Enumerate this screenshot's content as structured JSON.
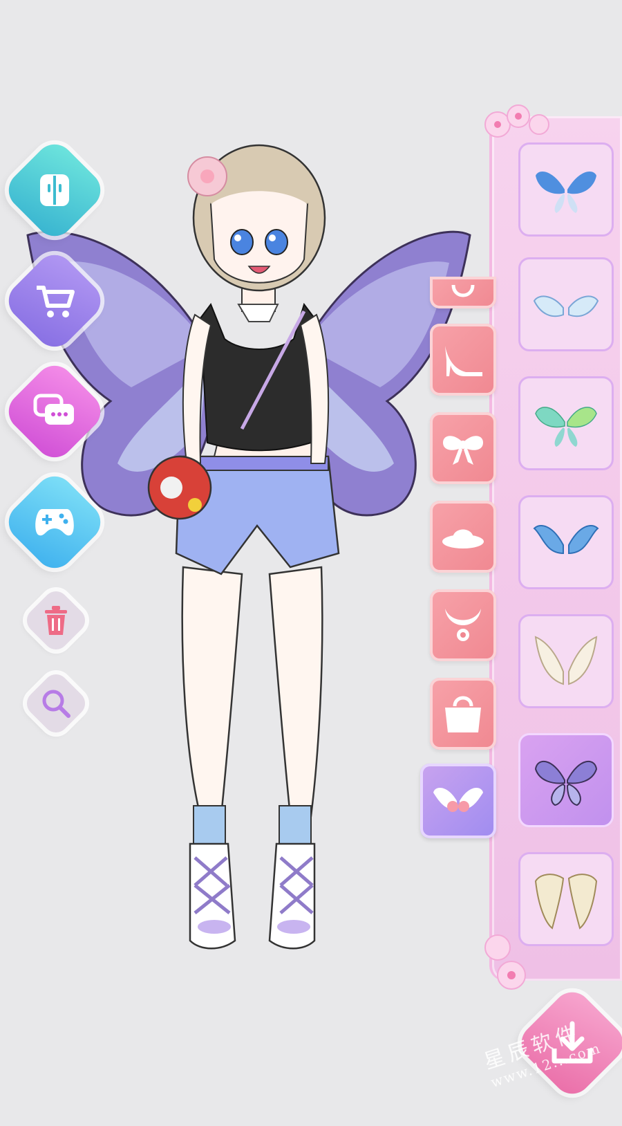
{
  "left_buttons": [
    {
      "name": "wardrobe-button",
      "icon": "wardrobe-icon",
      "color_top": "#5fe0d8",
      "color_bottom": "#38b7cf"
    },
    {
      "name": "shop-button",
      "icon": "cart-icon",
      "color_top": "#a88df0",
      "color_bottom": "#8a74e6"
    },
    {
      "name": "chat-button",
      "icon": "chat-icon",
      "color_top": "#f27de6",
      "color_bottom": "#d553d8"
    },
    {
      "name": "game-button",
      "icon": "gamepad-icon",
      "color_top": "#6ad6f5",
      "color_bottom": "#40b4ef"
    }
  ],
  "tool_buttons": [
    {
      "name": "delete-button",
      "icon": "trash-icon",
      "color": "#ee6b86"
    },
    {
      "name": "zoom-button",
      "icon": "magnifier-icon",
      "color": "#b77ce6"
    }
  ],
  "categories": [
    {
      "id": "necklace",
      "icon": "necklace-partial-icon",
      "active": false
    },
    {
      "id": "shoes",
      "icon": "high-heel-icon",
      "active": false
    },
    {
      "id": "bow",
      "icon": "bow-icon",
      "active": false
    },
    {
      "id": "hat",
      "icon": "hat-icon",
      "active": false
    },
    {
      "id": "collar",
      "icon": "collar-icon",
      "active": false
    },
    {
      "id": "bag",
      "icon": "handbag-icon",
      "active": false
    },
    {
      "id": "wings",
      "icon": "wings-icon",
      "active": true
    }
  ],
  "items": [
    {
      "id": "wing-blue-butterfly",
      "icon": "blue-butterfly-wings-icon",
      "selected": false,
      "color": "#4f8fdf"
    },
    {
      "id": "wing-white-angel-small",
      "icon": "white-angel-wings-icon",
      "selected": false,
      "color": "#cfe6f7"
    },
    {
      "id": "wing-green-butterfly",
      "icon": "green-butterfly-wings-icon",
      "selected": false,
      "color": "#7ed8c2"
    },
    {
      "id": "wing-blue-feather",
      "icon": "blue-feather-wings-icon",
      "selected": false,
      "color": "#6aa9e6"
    },
    {
      "id": "wing-cream-angel",
      "icon": "cream-angel-wings-icon",
      "selected": false,
      "color": "#f3ecdf"
    },
    {
      "id": "wing-purple-butterfly",
      "icon": "purple-butterfly-wings-icon",
      "selected": true,
      "color": "#8c7fd6"
    },
    {
      "id": "wing-golden-angel",
      "icon": "golden-angel-wings-icon",
      "selected": false,
      "color": "#f0e6c4"
    }
  ],
  "save_button": {
    "icon": "download-icon",
    "color": "#f27db1"
  },
  "watermark": {
    "line1": "星辰软件",
    "line2": "www.12...com"
  },
  "colors": {
    "background": "#e8e8ea",
    "panel": "#f5c8ec",
    "accent_pink": "#f08891",
    "accent_purple": "#a78cf0"
  }
}
